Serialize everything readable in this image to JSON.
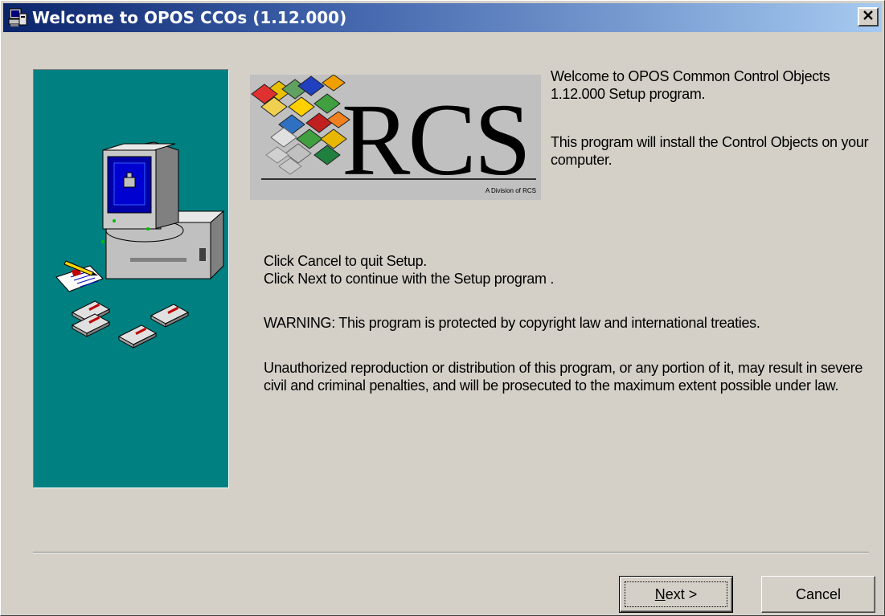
{
  "window": {
    "title": "Welcome to OPOS CCOs (1.12.000)",
    "close_glyph": "✕",
    "icons": {
      "title": "setup-computer-icon",
      "close": "close-icon"
    }
  },
  "logo": {
    "text": "RCS",
    "subtitle": "A Division of RCS"
  },
  "content": {
    "welcome": "Welcome to OPOS Common Control Objects 1.12.000 Setup program.",
    "install": "This program will install the Control Objects on your computer.",
    "cancel_hint": "Click Cancel to quit Setup.",
    "next_hint": "Click Next to continue with the Setup program .",
    "warning": "WARNING: This program is protected by copyright law and international treaties.",
    "unauthorized": "Unauthorized reproduction or distribution of this program, or any portion of it, may result in severe civil and criminal penalties, and will be prosecuted to the maximum extent possible under law."
  },
  "buttons": {
    "next_mnemonic": "N",
    "next_rest": "ext >",
    "cancel": "Cancel"
  },
  "colors": {
    "titlebar_start": "#0a246a",
    "titlebar_end": "#a6caf0",
    "side_panel": "#008080",
    "dialog_bg": "#d4d0c8"
  }
}
